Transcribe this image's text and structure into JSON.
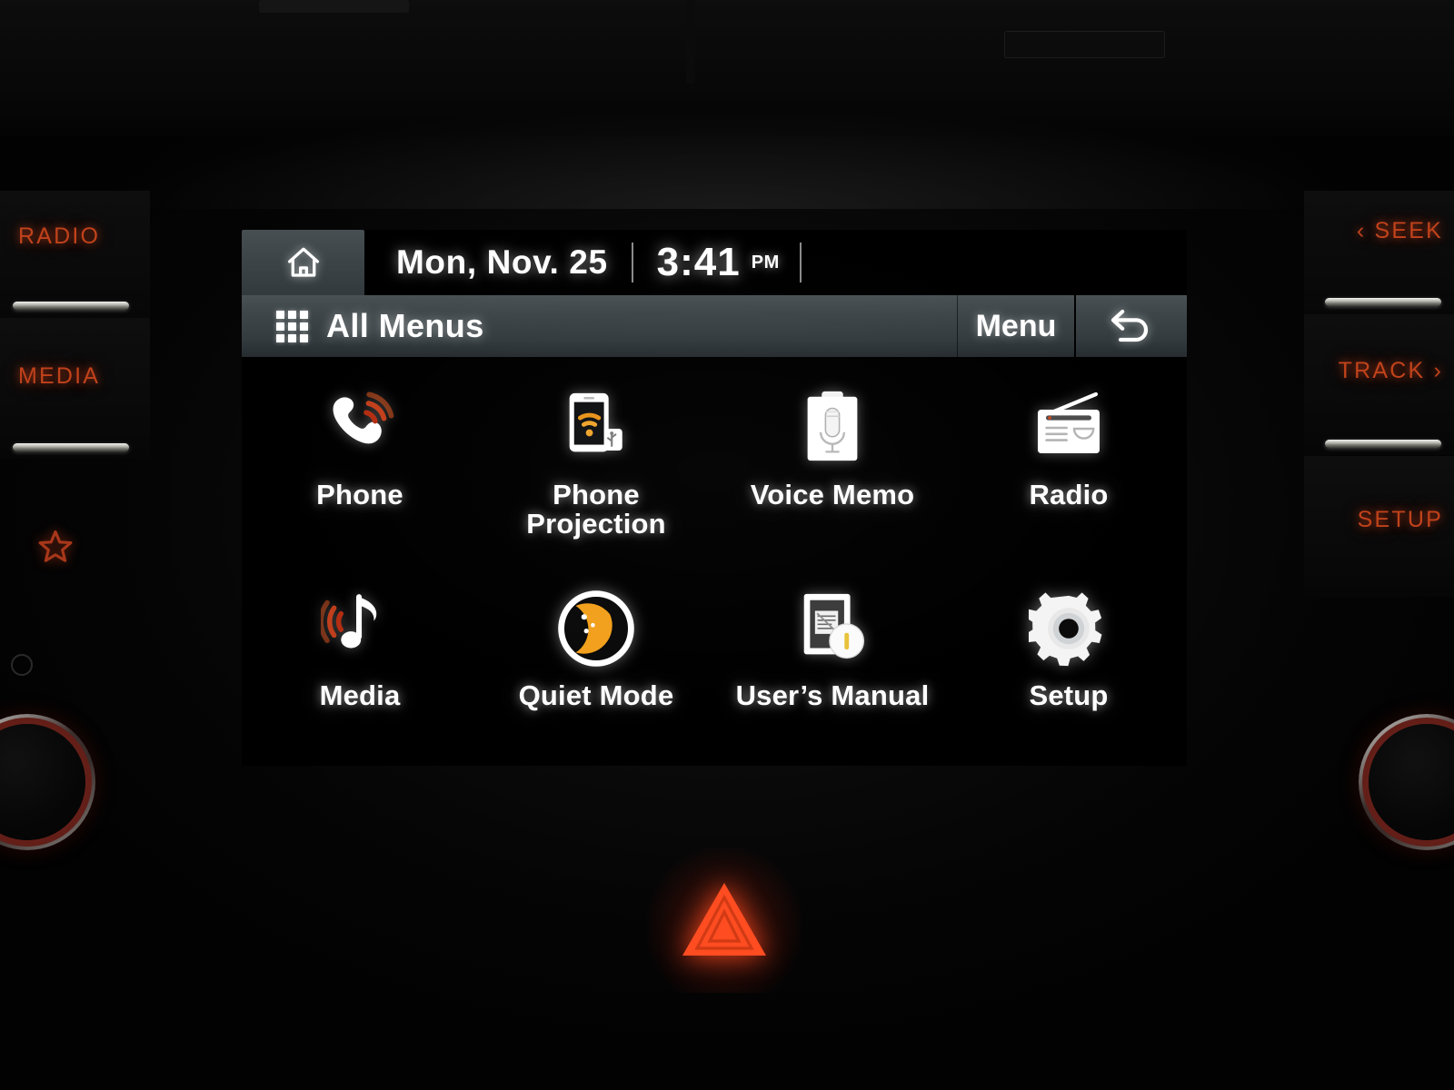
{
  "screen": {
    "status_bar": {
      "home_icon": "home-icon",
      "date": "Mon, Nov. 25",
      "time": "3:41",
      "ampm": "PM"
    },
    "title_bar": {
      "grid_icon": "grid-menu-icon",
      "title": "All Menus",
      "menu_label": "Menu",
      "back_icon": "back-arrow-icon"
    },
    "apps": [
      {
        "label": "Phone",
        "icon": "phone-handset-icon"
      },
      {
        "label": "Phone\nProjection",
        "icon": "phone-projection-icon"
      },
      {
        "label": "Voice Memo",
        "icon": "voice-memo-icon"
      },
      {
        "label": "Radio",
        "icon": "radio-icon"
      },
      {
        "label": "Media",
        "icon": "music-note-icon"
      },
      {
        "label": "Quiet Mode",
        "icon": "crescent-moon-icon"
      },
      {
        "label": "User’s Manual",
        "icon": "users-manual-icon"
      },
      {
        "label": "Setup",
        "icon": "gear-icon"
      }
    ]
  },
  "hardware": {
    "left_buttons": [
      {
        "label": "RADIO",
        "icon": "radio-hard-key"
      },
      {
        "label": "MEDIA",
        "icon": "media-hard-key"
      }
    ],
    "left_extra": {
      "star_icon": "star-favorite-icon",
      "power_icon": "power-icon"
    },
    "right_buttons": [
      {
        "label": "‹ SEEK",
        "icon": "seek-back-key"
      },
      {
        "label": "TRACK ›",
        "icon": "track-forward-key"
      },
      {
        "label": "SETUP",
        "icon": "setup-hard-key"
      }
    ],
    "knobs": [
      {
        "name": "power-volume-knob"
      },
      {
        "name": "tune-knob"
      }
    ],
    "hazard": {
      "name": "hazard-warning-button",
      "icon": "hazard-triangle-icon"
    }
  },
  "colors": {
    "backlight_orange": "#c0421b",
    "hazard_red": "#ff4a22",
    "accent_orange": "#f59a1e",
    "panel_gray": "#3e4649",
    "screen_black": "#000000"
  }
}
